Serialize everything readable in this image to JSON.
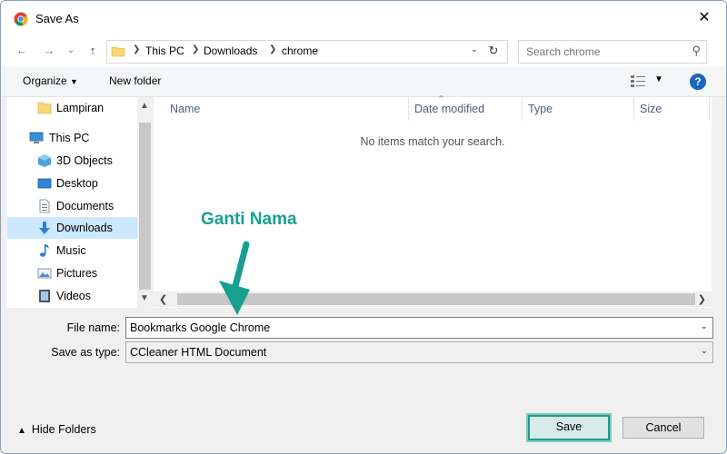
{
  "window": {
    "title": "Save As"
  },
  "address": {
    "crumbs": [
      "This PC",
      "Downloads",
      "chrome"
    ]
  },
  "search": {
    "placeholder": "Search chrome"
  },
  "toolbar": {
    "organize_label": "Organize",
    "new_folder_label": "New folder"
  },
  "nav": {
    "items": [
      {
        "label": "Lampiran",
        "icon": "folder-icon"
      },
      {
        "label": "This PC",
        "icon": "computer-icon"
      },
      {
        "label": "3D Objects",
        "icon": "cube-icon"
      },
      {
        "label": "Desktop",
        "icon": "desktop-icon"
      },
      {
        "label": "Documents",
        "icon": "document-icon"
      },
      {
        "label": "Downloads",
        "icon": "download-icon",
        "selected": true
      },
      {
        "label": "Music",
        "icon": "music-icon"
      },
      {
        "label": "Pictures",
        "icon": "pictures-icon"
      },
      {
        "label": "Videos",
        "icon": "video-icon"
      }
    ]
  },
  "files": {
    "columns": [
      "Name",
      "Date modified",
      "Type",
      "Size"
    ],
    "empty_message": "No items match your search."
  },
  "form": {
    "file_name_label": "File name:",
    "file_name_value": "Bookmarks Google Chrome",
    "save_type_label": "Save as type:",
    "save_type_value": "CCleaner HTML Document"
  },
  "footer": {
    "hide_folders_label": "Hide Folders",
    "save_label": "Save",
    "cancel_label": "Cancel"
  },
  "annotation": {
    "text": "Ganti Nama",
    "color": "#17a08f"
  },
  "colors": {
    "accent": "#17a08f",
    "selection": "#cce8ff",
    "help": "#1a66c2"
  }
}
